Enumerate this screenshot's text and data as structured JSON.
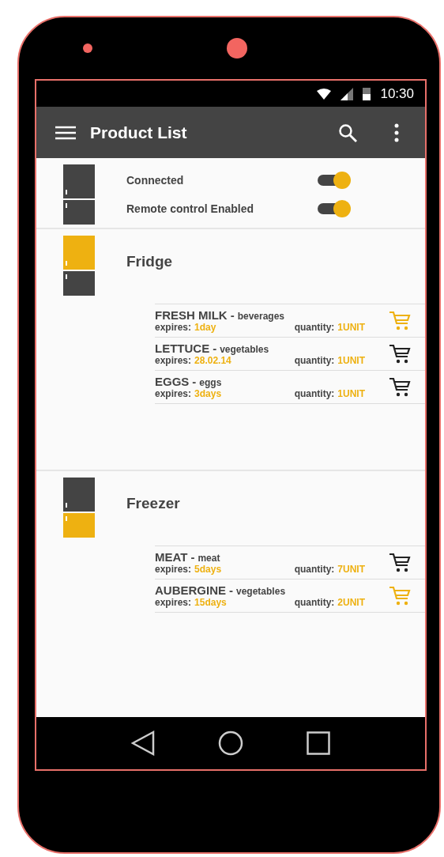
{
  "status_bar": {
    "time": "10:30"
  },
  "app_bar": {
    "title": "Product List"
  },
  "device": {
    "top_selected": false,
    "bottom_selected": false,
    "toggles": [
      {
        "label": "Connected",
        "on": true
      },
      {
        "label": "Remote control Enabled",
        "on": true
      }
    ]
  },
  "sections": [
    {
      "title": "Fridge",
      "top_selected": true,
      "bottom_selected": false,
      "items": [
        {
          "name": "FRESH MILK",
          "separator": "-",
          "category": "beverages",
          "expires_label": "expires:",
          "expires": "1day",
          "quantity_label": "quantity:",
          "quantity": "1UNIT",
          "highlighted": true
        },
        {
          "name": "LETTUCE",
          "separator": "-",
          "category": "vegetables",
          "expires_label": "expires:",
          "expires": "28.02.14",
          "quantity_label": "quantity:",
          "quantity": "1UNIT",
          "highlighted": false
        },
        {
          "name": "EGGS",
          "separator": "-",
          "category": "eggs",
          "expires_label": "expires:",
          "expires": "3days",
          "quantity_label": "quantity:",
          "quantity": "1UNIT",
          "highlighted": false
        }
      ]
    },
    {
      "title": "Freezer",
      "top_selected": false,
      "bottom_selected": true,
      "items": [
        {
          "name": "MEAT",
          "separator": "-",
          "category": "meat",
          "expires_label": "expires:",
          "expires": "5days",
          "quantity_label": "quantity:",
          "quantity": "7UNIT",
          "highlighted": false
        },
        {
          "name": "AUBERGINE",
          "separator": "-",
          "category": "vegetables",
          "expires_label": "expires:",
          "expires": "15days",
          "quantity_label": "quantity:",
          "quantity": "2UNIT",
          "highlighted": true
        }
      ]
    }
  ]
}
